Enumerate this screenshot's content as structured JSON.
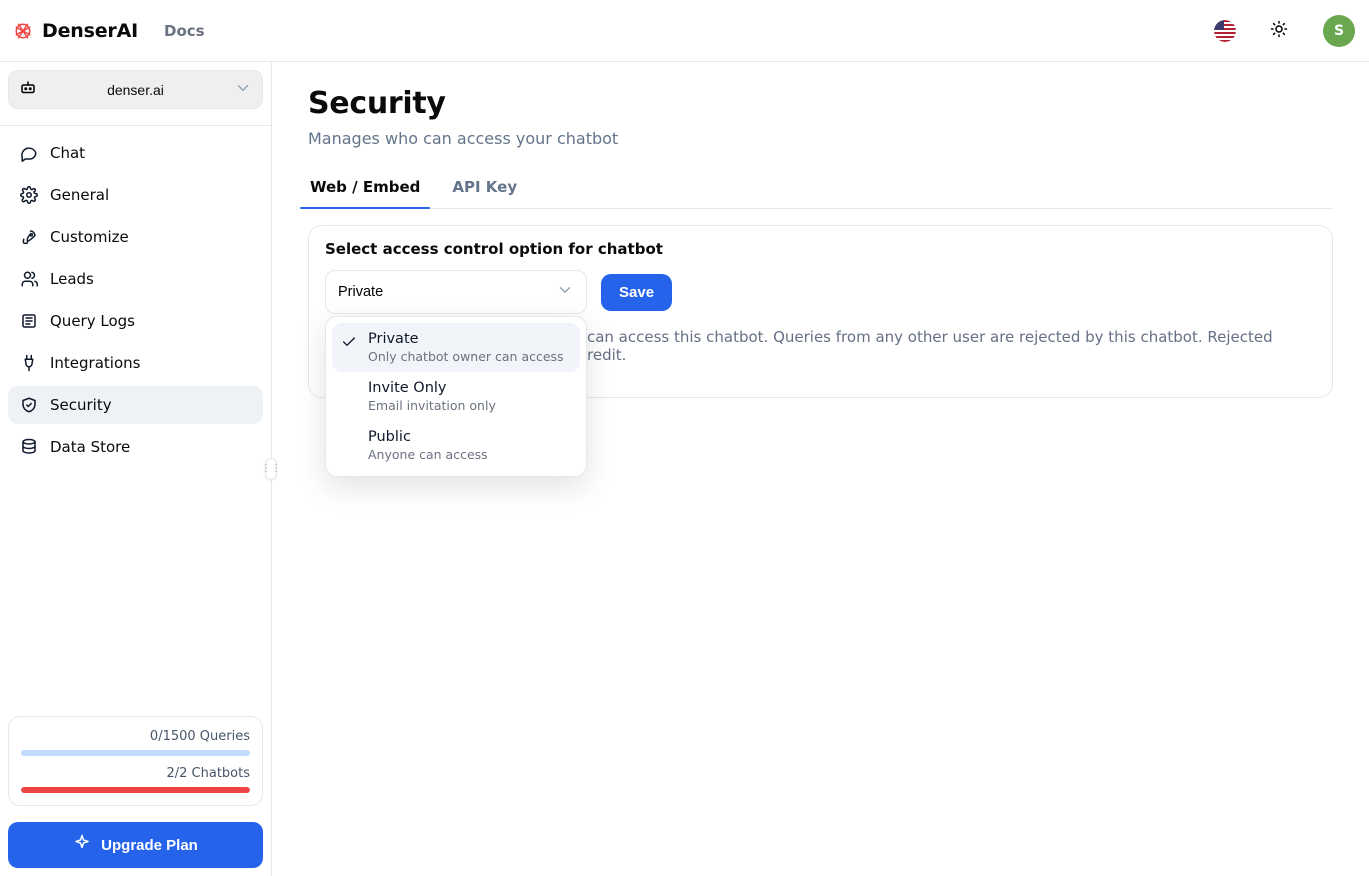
{
  "brand": {
    "name": "DenserAI"
  },
  "nav": {
    "docs": "Docs"
  },
  "header": {
    "avatar_initial": "S"
  },
  "workspace": {
    "name": "denser.ai"
  },
  "sidebar": {
    "items": [
      {
        "icon": "chat",
        "label": "Chat"
      },
      {
        "icon": "settings",
        "label": "General"
      },
      {
        "icon": "rocket",
        "label": "Customize"
      },
      {
        "icon": "users",
        "label": "Leads"
      },
      {
        "icon": "logs",
        "label": "Query Logs"
      },
      {
        "icon": "plug",
        "label": "Integrations"
      },
      {
        "icon": "shield",
        "label": "Security"
      },
      {
        "icon": "data",
        "label": "Data Store"
      }
    ],
    "active_index": 6
  },
  "usage": {
    "queries_label": "0/1500 Queries",
    "queries_pct": 0,
    "chatbots_label": "2/2 Chatbots",
    "chatbots_pct": 100,
    "upgrade_label": "Upgrade Plan"
  },
  "page": {
    "title": "Security",
    "subtitle": "Manages who can access your chatbot"
  },
  "tabs": {
    "items": [
      "Web / Embed",
      "API Key"
    ],
    "active_index": 0
  },
  "access_panel": {
    "label": "Select access control option for chatbot",
    "selected": "Private",
    "save_label": "Save",
    "helper_text": "Private means only chatbot owner can access this chatbot. Queries from any other user are rejected by this chatbot. Rejected queries does not cost chat usage credit.",
    "options": [
      {
        "title": "Private",
        "subtitle": "Only chatbot owner can access",
        "selected": true
      },
      {
        "title": "Invite Only",
        "subtitle": "Email invitation only",
        "selected": false
      },
      {
        "title": "Public",
        "subtitle": "Anyone can access",
        "selected": false
      }
    ]
  },
  "colors": {
    "blue": "#2563eb",
    "red": "#ef4444"
  }
}
